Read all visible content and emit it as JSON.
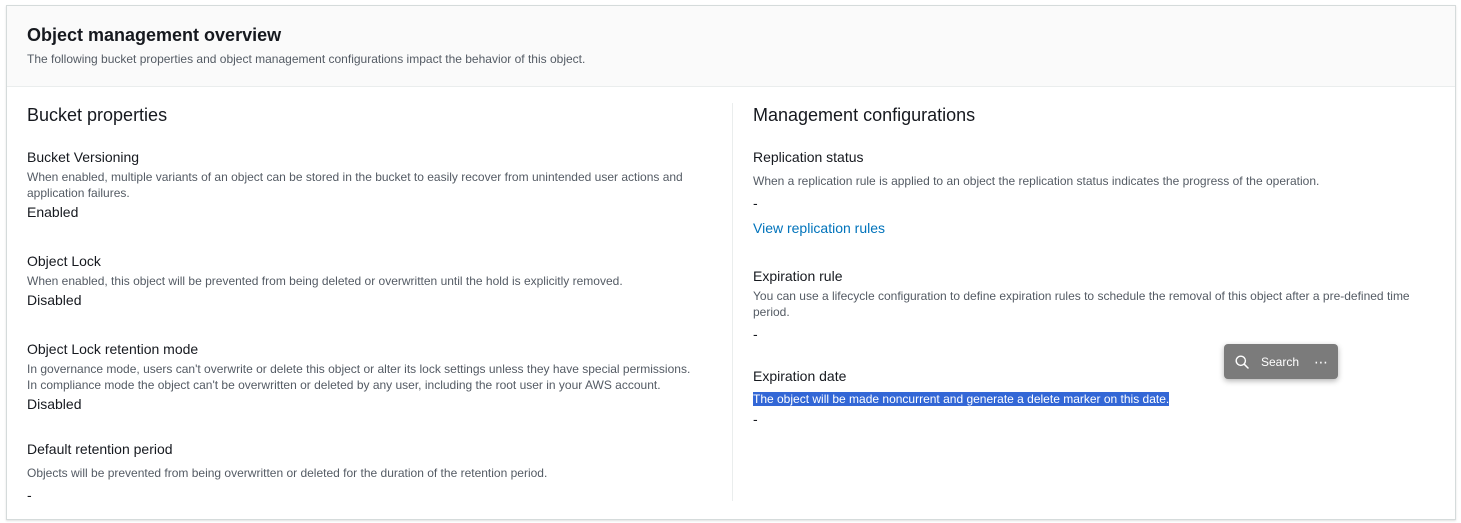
{
  "header": {
    "title": "Object management overview",
    "description": "The following bucket properties and object management configurations impact the behavior of this object."
  },
  "bucket_properties": {
    "title": "Bucket properties",
    "fields": [
      {
        "label": "Bucket Versioning",
        "description": "When enabled, multiple variants of an object can be stored in the bucket to easily recover from unintended user actions and application failures.",
        "value": "Enabled"
      },
      {
        "label": "Object Lock",
        "description": "When enabled, this object will be prevented from being deleted or overwritten until the hold is explicitly removed.",
        "value": "Disabled"
      },
      {
        "label": "Object Lock retention mode",
        "description_lines": [
          "In governance mode, users can't overwrite or delete this object or alter its lock settings unless they have special permissions.",
          "In compliance mode the object can't be overwritten or deleted by any user, including the root user in your AWS account."
        ],
        "value": "Disabled"
      },
      {
        "label": "Default retention period",
        "description": "Objects will be prevented from being overwritten or deleted for the duration of the retention period.",
        "value": "-"
      }
    ]
  },
  "management_configurations": {
    "title": "Management configurations",
    "fields": [
      {
        "label": "Replication status",
        "description": "When a replication rule is applied to an object the replication status indicates the progress of the operation.",
        "value": "-",
        "link": "View replication rules"
      },
      {
        "label": "Expiration rule",
        "description": "You can use a lifecycle configuration to define expiration rules to schedule the removal of this object after a pre-defined time period.",
        "value": "-"
      },
      {
        "label": "Expiration date",
        "description": "The object will be made noncurrent and generate a delete marker on this date.",
        "value": "-"
      }
    ]
  },
  "search_popup": {
    "search_label": "Search",
    "more_label": "⋯",
    "search_icon": "magnifier-icon"
  },
  "colors": {
    "link": "#0073bb",
    "selection": "#3367d6",
    "header_bg": "#fafafa",
    "popup_bg": "#7b7b7b"
  }
}
